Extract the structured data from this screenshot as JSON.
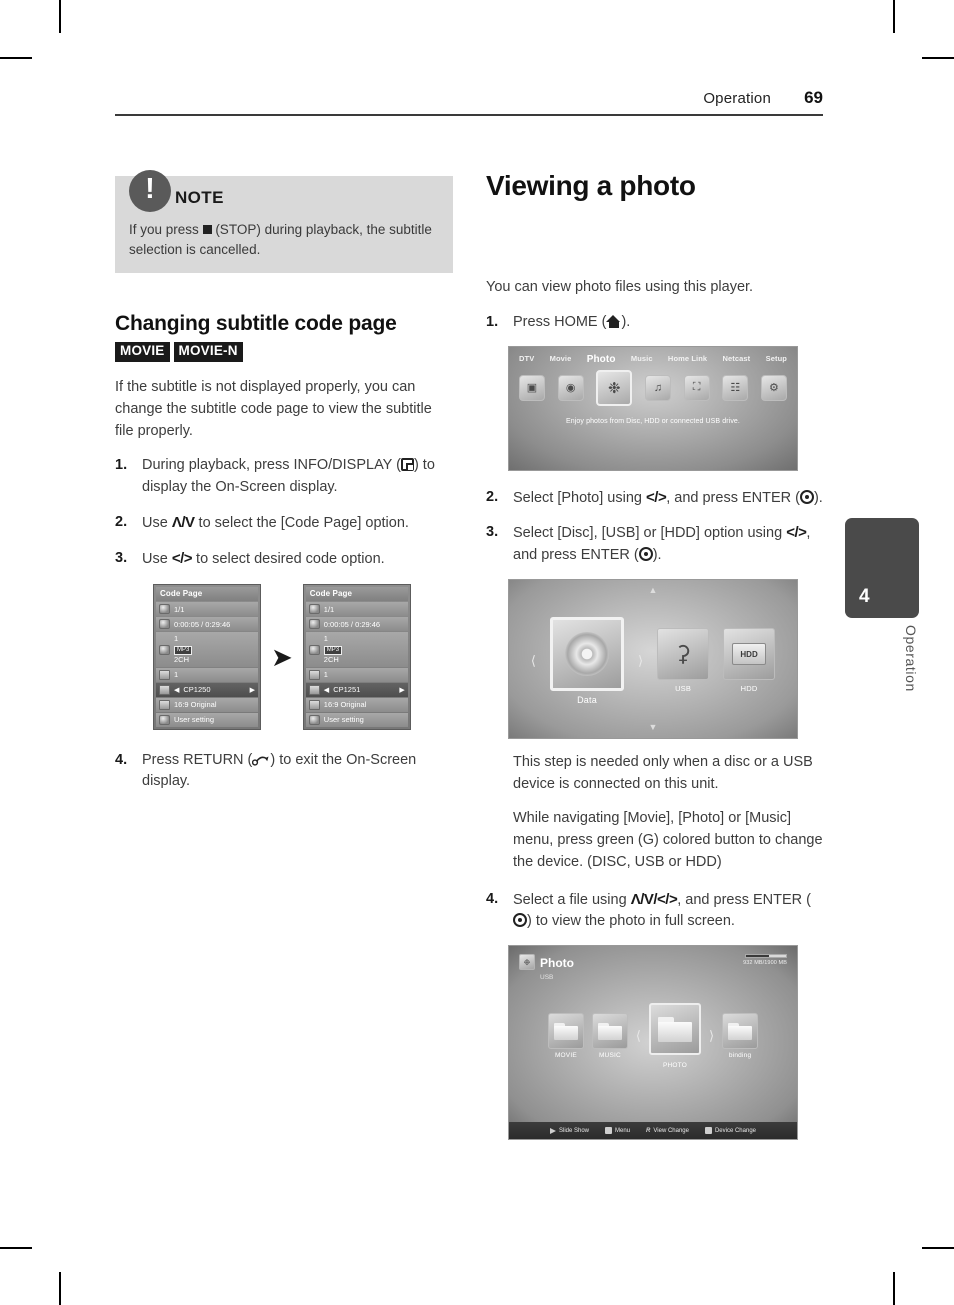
{
  "header": {
    "section": "Operation",
    "page_number": "69"
  },
  "side_tab": {
    "number": "4",
    "label": "Operation"
  },
  "note": {
    "icon": "exclamation-icon",
    "title": "NOTE",
    "body_before": "If you press",
    "body_after": "(STOP) during playback, the subtitle selection is cancelled."
  },
  "left_column": {
    "heading": "Changing subtitle code page",
    "badges": [
      "MOVIE",
      "MOVIE-N"
    ],
    "intro": "If the subtitle is not displayed properly, you can change the subtitle code page to view the subtitle file properly.",
    "steps": [
      {
        "num": "1.",
        "a": "During playback, press INFO/DISPLAY (",
        "icon": "display-icon",
        "b": ") to display the On-Screen display."
      },
      {
        "num": "2.",
        "a": "Use",
        "keys": "Λ/V",
        "b": "to select the [Code Page] option."
      },
      {
        "num": "3.",
        "a": "Use",
        "keys": "</>",
        "b": "to select desired code option."
      },
      {
        "num": "4.",
        "a": "Press RETURN (",
        "icon": "return-icon",
        "b": ") to exit the On-Screen display."
      }
    ],
    "osd": {
      "title": "Code Page",
      "rows_left": [
        {
          "icon": "title-icon",
          "text": "1/1"
        },
        {
          "icon": "time-icon",
          "text": "0:00:05 / 0:29:46"
        },
        {
          "icon": "audio-icon",
          "line1": "1",
          "tag": "MP3",
          "line3": "2CH"
        },
        {
          "icon": "subtitle-icon",
          "text": "1"
        },
        {
          "icon": "codepage-icon",
          "text": "CP1250",
          "selected": true
        },
        {
          "icon": "aspect-icon",
          "text": "16:9 Original"
        },
        {
          "icon": "picture-icon",
          "text": "User setting"
        }
      ],
      "rows_right": [
        {
          "icon": "title-icon",
          "text": "1/1"
        },
        {
          "icon": "time-icon",
          "text": "0:00:05 / 0:29:46"
        },
        {
          "icon": "audio-icon",
          "line1": "1",
          "tag": "MP3",
          "line3": "2CH"
        },
        {
          "icon": "subtitle-icon",
          "text": "1"
        },
        {
          "icon": "codepage-icon",
          "text": "CP1251",
          "selected": true
        },
        {
          "icon": "aspect-icon",
          "text": "16:9 Original"
        },
        {
          "icon": "picture-icon",
          "text": "User setting"
        }
      ],
      "transition_arrow": "➤"
    }
  },
  "right_column": {
    "heading": "Viewing a photo",
    "intro": "You can view photo files using this player.",
    "steps": [
      {
        "num": "1.",
        "a": "Press HOME (",
        "icon": "home-icon",
        "b": ")."
      },
      {
        "num": "2.",
        "a": "Select [Photo] using",
        "keys": "</>",
        "b": ", and press ENTER (",
        "icon": "enter-icon",
        "c": ")."
      },
      {
        "num": "3.",
        "a": "Select [Disc], [USB] or [HDD] option using",
        "keys": "</>",
        "b": ", and press ENTER (",
        "icon": "enter-icon",
        "c": ")."
      },
      {
        "num": "4.",
        "a": "Select a file using",
        "keys": "Λ/V/</>",
        "b": ", and press ENTER (",
        "icon": "enter-icon",
        "c": ") to view the photo in full screen."
      }
    ],
    "note_para_1": "This step is needed only when a disc or a USB device is connected on this unit.",
    "note_para_2": "While navigating [Movie], [Photo] or [Music] menu, press green (G) colored button to change the device. (DISC, USB or HDD)",
    "home_menu": {
      "items": [
        "DTV",
        "Movie",
        "Photo",
        "Music",
        "Home Link",
        "Netcast",
        "Setup"
      ],
      "active": "Photo",
      "icons": [
        "tv-icon",
        "film-icon",
        "photo-icon",
        "music-note-icon",
        "home-link-icon",
        "netcast-icon",
        "gear-icon"
      ],
      "caption": "Enjoy photos from Disc, HDD or connected USB drive."
    },
    "device_menu": {
      "tiles": [
        {
          "label": "Data",
          "icon": "disc-icon",
          "selected": true
        },
        {
          "label": "USB",
          "icon": "usb-icon",
          "selected": false
        },
        {
          "label": "HDD",
          "icon": "hdd-icon",
          "selected": false
        }
      ]
    },
    "photo_browser": {
      "title": "Photo",
      "source": "USB",
      "icon": "photo-icon",
      "storage": "932 MB/1900 MB",
      "folders": [
        {
          "label": "MOVIE",
          "selected": false
        },
        {
          "label": "MUSIC",
          "selected": false
        },
        {
          "label": "PHOTO",
          "selected": true
        },
        {
          "label": "binding",
          "selected": false
        }
      ],
      "buttons": [
        {
          "glyph": "play-icon",
          "label": "Slide Show"
        },
        {
          "glyph": "menu-icon",
          "label": "Menu"
        },
        {
          "glyph": "red-button-icon",
          "label": "View Change"
        },
        {
          "glyph": "green-button-icon",
          "label": "Device Change"
        }
      ]
    }
  }
}
